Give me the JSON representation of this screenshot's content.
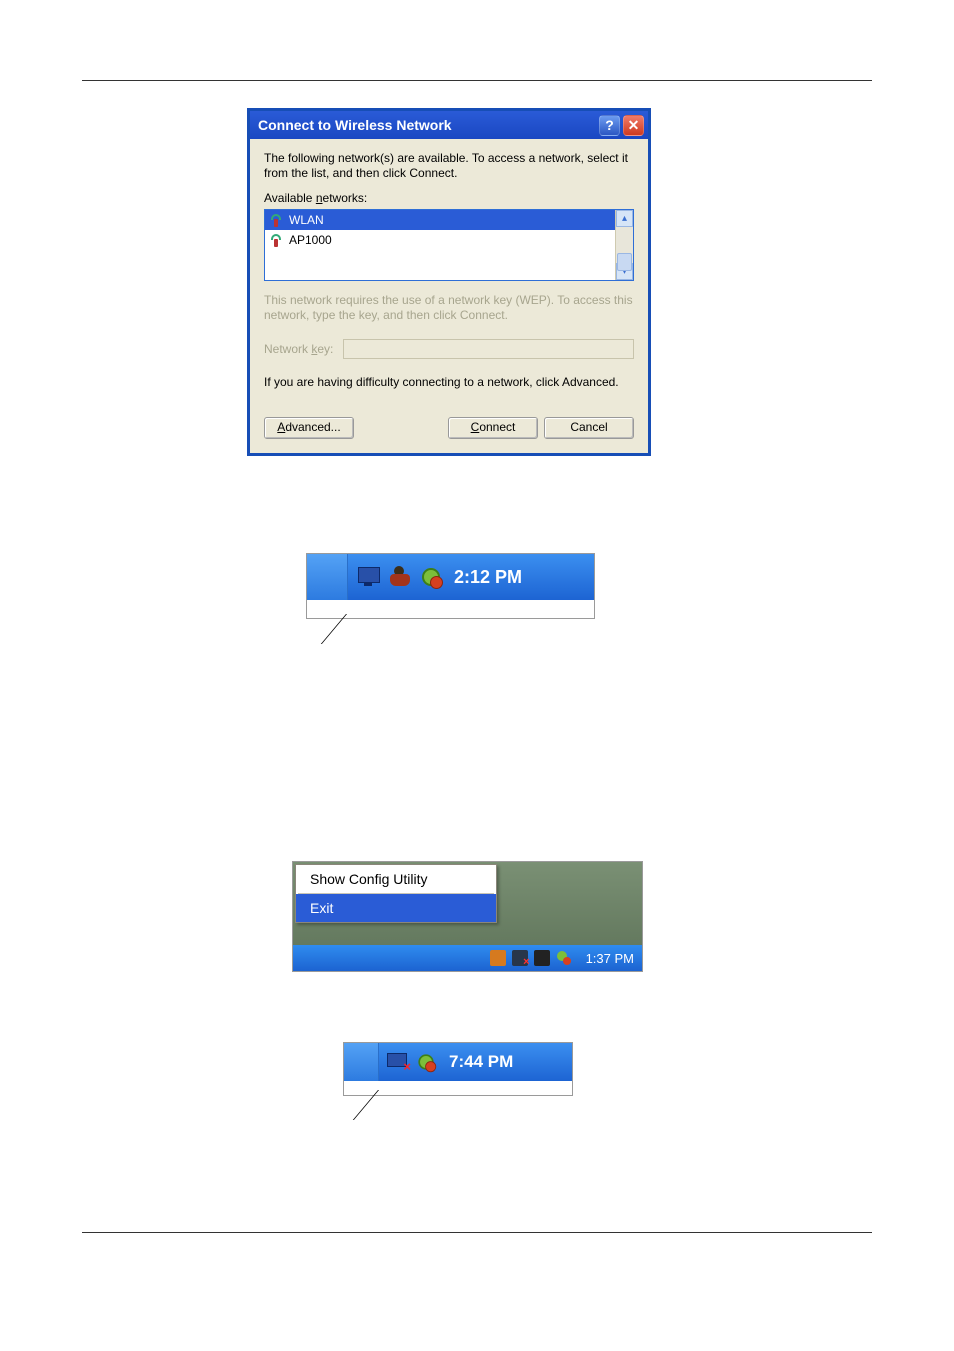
{
  "dialog": {
    "title": "Connect to Wireless Network",
    "instruction": "The following network(s) are available. To access a network, select it from the list, and then click Connect.",
    "available_label_prefix": "Available ",
    "available_label_u": "n",
    "available_label_suffix": "etworks:",
    "networks": [
      {
        "name": "WLAN",
        "selected": true
      },
      {
        "name": "AP1000",
        "selected": false
      }
    ],
    "wep_note": "This network requires the use of a network key (WEP). To access this network, type the key, and then click Connect.",
    "key_label_prefix": "Network ",
    "key_label_u": "k",
    "key_label_suffix": "ey:",
    "key_value": "",
    "advanced_note": "If you are having difficulty connecting to a network, click Advanced.",
    "advanced_btn_u": "A",
    "advanced_btn_rest": "dvanced...",
    "connect_btn_u": "C",
    "connect_btn_rest": "onnect",
    "cancel_btn": "Cancel",
    "help_glyph": "?",
    "close_glyph": "✕"
  },
  "tray1": {
    "time": "2:12 PM",
    "icons": [
      "monitor-icon",
      "agent-icon",
      "antivirus-icon"
    ]
  },
  "tray2": {
    "menu": [
      {
        "label": "Show Config Utility",
        "hover": false
      },
      {
        "label": "Exit",
        "hover": true
      }
    ],
    "time": "1:37 PM",
    "icons": [
      "lang-icon",
      "net-off-icon",
      "device-icon",
      "antivirus-icon"
    ]
  },
  "tray3": {
    "time": "7:44 PM",
    "icons": [
      "monitor-off-icon",
      "antivirus-icon"
    ]
  }
}
